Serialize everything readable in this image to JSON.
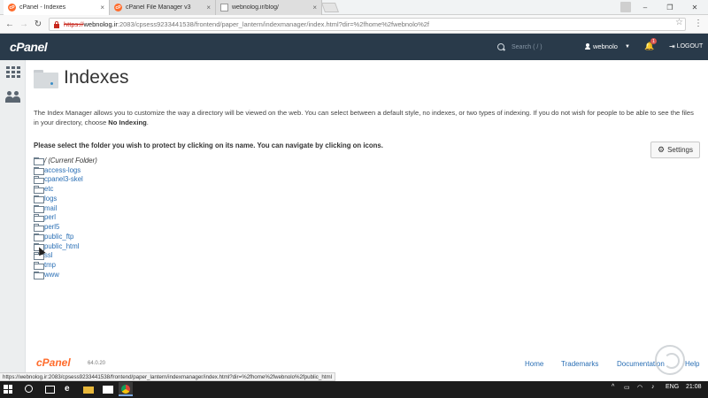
{
  "browser": {
    "tabs": [
      {
        "label": "cPanel - Indexes",
        "favicon": "cpanel-icon",
        "active": true
      },
      {
        "label": "cPanel File Manager v3",
        "favicon": "cpanel-icon",
        "active": false
      },
      {
        "label": "webnolog.ir/blog/",
        "favicon": "page-icon",
        "active": false
      }
    ],
    "url": {
      "scheme": "https://",
      "domain": "webnolog.ir",
      "rest": ":2083/cpsess9233441538/frontend/paper_lantern/indexmanager/index.html?dir=%2fhome%2fwebnolo%2f"
    },
    "status_url": "https://webnolog.ir:2083/cpsess9233441538/frontend/paper_lantern/indexmanager/index.html?dir=%2fhome%2fwebnolo%2fpublic_html"
  },
  "header": {
    "logo": "cPanel",
    "search_placeholder": "Search ( / )",
    "username": "webnolo",
    "notification_count": "1",
    "logout_label": "LOGOUT"
  },
  "page": {
    "title": "Indexes",
    "description_main": "The Index Manager allows you to customize the way a directory will be viewed on the web. You can select between a default style, no indexes, or two types of indexing. If you do not wish for people to be able to see the files in your directory, choose ",
    "description_bold": "No Indexing",
    "description_end": ".",
    "instruction": "Please select the folder you wish to protect by clicking on its name. You can navigate by clicking on icons.",
    "settings_label": "Settings",
    "folders": [
      "/ (Current Folder)",
      "access-logs",
      "cpanel3-skel",
      "etc",
      "logs",
      "mail",
      "perl",
      "perl5",
      "public_ftp",
      "public_html",
      "ssl",
      "tmp",
      "www"
    ]
  },
  "footer": {
    "logo": "cPanel",
    "version": "64.0.20",
    "links": [
      "Home",
      "Trademarks",
      "Documentation",
      "Help"
    ]
  },
  "taskbar": {
    "language": "ENG",
    "time": "21:08"
  },
  "colors": {
    "topbar": "#293a4a",
    "link": "#2a6fb5",
    "brand_orange": "#ff6c2c"
  }
}
